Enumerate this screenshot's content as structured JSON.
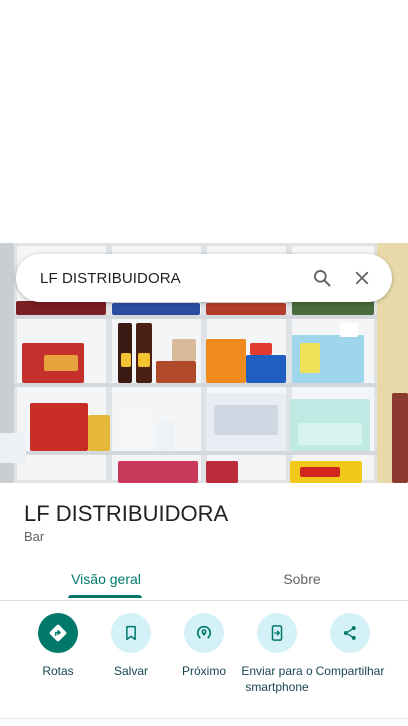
{
  "search": {
    "query": "LF DISTRIBUIDORA"
  },
  "place": {
    "name": "LF DISTRIBUIDORA",
    "category": "Bar"
  },
  "tabs": [
    {
      "label": "Visão geral",
      "active": true
    },
    {
      "label": "Sobre",
      "active": false
    }
  ],
  "actions": [
    {
      "label": "Rotas",
      "icon": "directions-icon"
    },
    {
      "label": "Salvar",
      "icon": "bookmark-icon"
    },
    {
      "label": "Próximo",
      "icon": "nearby-icon"
    },
    {
      "label": "Enviar para o smartphone",
      "icon": "send-to-phone-icon"
    },
    {
      "label": "Compartilhar",
      "icon": "share-icon"
    }
  ],
  "colors": {
    "accent": "#00796b",
    "action_bg": "#d3f1f7",
    "action_text": "#174650"
  }
}
